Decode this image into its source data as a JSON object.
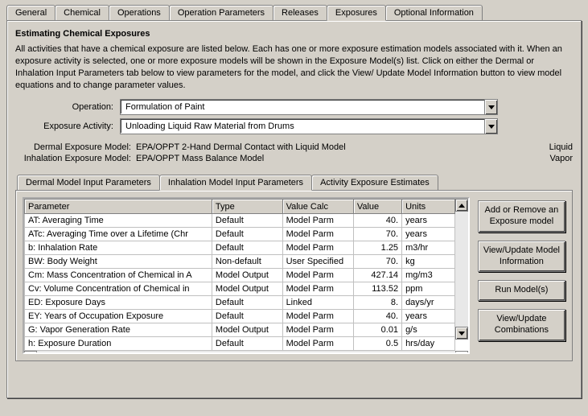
{
  "top_tabs": {
    "general": "General",
    "chemical": "Chemical",
    "operations": "Operations",
    "operation_parameters": "Operation Parameters",
    "releases": "Releases",
    "exposures": "Exposures",
    "optional_information": "Optional Information"
  },
  "group_title": "Estimating Chemical Exposures",
  "instructions": "All activities that have a chemical exposure are listed below.  Each has one or more exposure estimation models associated with it.  When an exposure activity is selected, one or more exposure models will be shown in the Exposure Model(s) list.  Click on either the Dermal or Inhalation Input Parameters tab below to view parameters for the model, and click the View/ Update Model Information button to view model equations and to change parameter values.",
  "dropdowns": {
    "operation_label": "Operation:",
    "operation_value": "Formulation of Paint",
    "activity_label": "Exposure Activity:",
    "activity_value": "Unloading Liquid Raw Material from Drums"
  },
  "models": {
    "dermal_label": "Dermal Exposure Model:",
    "dermal_value": "EPA/OPPT 2-Hand Dermal Contact with Liquid Model",
    "dermal_state": "Liquid",
    "inhalation_label": "Inhalation Exposure Model:",
    "inhalation_value": "EPA/OPPT Mass Balance Model",
    "inhalation_state": "Vapor"
  },
  "sub_tabs": {
    "dermal": "Dermal Model Input Parameters",
    "inhalation": "Inhalation Model Input Parameters",
    "activity": "Activity Exposure Estimates"
  },
  "table": {
    "headers": {
      "parameter": "Parameter",
      "type": "Type",
      "value_calc": "Value Calc",
      "value": "Value",
      "units": "Units"
    },
    "rows": [
      {
        "parameter": "AT: Averaging Time",
        "type": "Default",
        "value_calc": "Model Parm",
        "value": "40.",
        "units": "years"
      },
      {
        "parameter": "ATc: Averaging Time over a Lifetime (Chr",
        "type": "Default",
        "value_calc": "Model Parm",
        "value": "70.",
        "units": "years"
      },
      {
        "parameter": "b: Inhalation Rate",
        "type": "Default",
        "value_calc": "Model Parm",
        "value": "1.25",
        "units": "m3/hr"
      },
      {
        "parameter": "BW: Body Weight",
        "type": "Non-default",
        "value_calc": "User Specified",
        "value": "70.",
        "units": "kg"
      },
      {
        "parameter": "Cm: Mass Concentration of Chemical in A",
        "type": "Model Output",
        "value_calc": "Model Parm",
        "value": "427.14",
        "units": "mg/m3"
      },
      {
        "parameter": "Cv: Volume Concentration of Chemical in",
        "type": "Model Output",
        "value_calc": "Model Parm",
        "value": "113.52",
        "units": "ppm"
      },
      {
        "parameter": "ED: Exposure Days",
        "type": "Default",
        "value_calc": "Linked",
        "value": "8.",
        "units": "days/yr"
      },
      {
        "parameter": "EY: Years of Occupation Exposure",
        "type": "Default",
        "value_calc": "Model Parm",
        "value": "40.",
        "units": "years"
      },
      {
        "parameter": "G: Vapor Generation Rate",
        "type": "Model Output",
        "value_calc": "Model Parm",
        "value": "0.01",
        "units": "g/s"
      },
      {
        "parameter": "h: Exposure Duration",
        "type": "Default",
        "value_calc": "Model Parm",
        "value": "0.5",
        "units": "hrs/day"
      }
    ]
  },
  "buttons": {
    "add_remove": "Add or Remove an Exposure model",
    "view_model_info": "View/Update Model Information",
    "run_models": "Run Model(s)",
    "view_combinations": "View/Update Combinations"
  }
}
